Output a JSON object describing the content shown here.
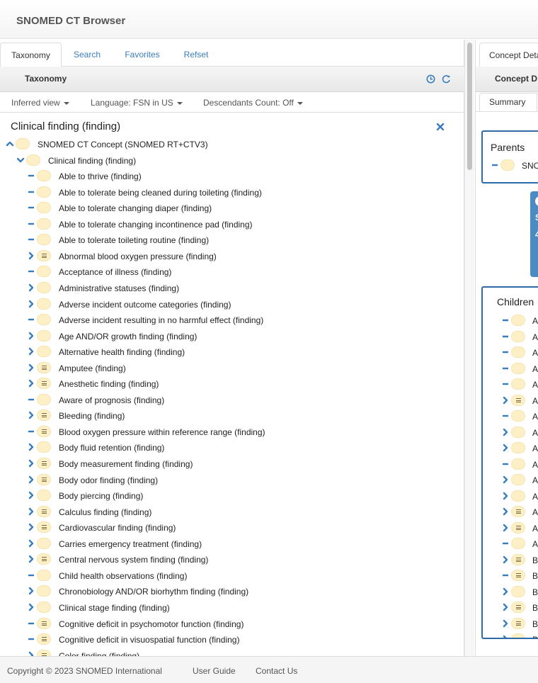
{
  "app": {
    "title": "SNOMED CT Browser"
  },
  "left_tabs": [
    "Taxonomy",
    "Search",
    "Favorites",
    "Refset"
  ],
  "taxonomy_panel": {
    "heading": "Taxonomy",
    "icons": [
      "history-icon",
      "refresh-icon"
    ],
    "view_dropdown": "Inferred view",
    "language_dropdown": "Language: FSN in US",
    "descendants_dropdown": "Descendants Count: Off",
    "selected_concept": "Clinical finding (finding)"
  },
  "tree": [
    {
      "label": "SNOMED CT Concept (SNOMED RT+CTV3)",
      "level": 0,
      "toggle": "collapse",
      "defined": false
    },
    {
      "label": "Clinical finding (finding)",
      "level": 1,
      "toggle": "expanded",
      "defined": false
    },
    {
      "label": "Able to thrive (finding)",
      "level": 2,
      "toggle": "leaf",
      "defined": false
    },
    {
      "label": "Able to tolerate being cleaned during toileting (finding)",
      "level": 2,
      "toggle": "leaf",
      "defined": false
    },
    {
      "label": "Able to tolerate changing diaper (finding)",
      "level": 2,
      "toggle": "leaf",
      "defined": false
    },
    {
      "label": "Able to tolerate changing incontinence pad (finding)",
      "level": 2,
      "toggle": "leaf",
      "defined": false
    },
    {
      "label": "Able to tolerate toileting routine (finding)",
      "level": 2,
      "toggle": "leaf",
      "defined": false
    },
    {
      "label": "Abnormal blood oxygen pressure (finding)",
      "level": 2,
      "toggle": "expand",
      "defined": true
    },
    {
      "label": "Acceptance of illness (finding)",
      "level": 2,
      "toggle": "leaf",
      "defined": false
    },
    {
      "label": "Administrative statuses (finding)",
      "level": 2,
      "toggle": "expand",
      "defined": false
    },
    {
      "label": "Adverse incident outcome categories (finding)",
      "level": 2,
      "toggle": "expand",
      "defined": false
    },
    {
      "label": "Adverse incident resulting in no harmful effect (finding)",
      "level": 2,
      "toggle": "leaf",
      "defined": false
    },
    {
      "label": "Age AND/OR growth finding (finding)",
      "level": 2,
      "toggle": "expand",
      "defined": false
    },
    {
      "label": "Alternative health finding (finding)",
      "level": 2,
      "toggle": "expand",
      "defined": false
    },
    {
      "label": "Amputee (finding)",
      "level": 2,
      "toggle": "expand",
      "defined": true
    },
    {
      "label": "Anesthetic finding (finding)",
      "level": 2,
      "toggle": "expand",
      "defined": true
    },
    {
      "label": "Aware of prognosis (finding)",
      "level": 2,
      "toggle": "leaf",
      "defined": false
    },
    {
      "label": "Bleeding (finding)",
      "level": 2,
      "toggle": "expand",
      "defined": true
    },
    {
      "label": "Blood oxygen pressure within reference range (finding)",
      "level": 2,
      "toggle": "leaf",
      "defined": true
    },
    {
      "label": "Body fluid retention (finding)",
      "level": 2,
      "toggle": "expand",
      "defined": false
    },
    {
      "label": "Body measurement finding (finding)",
      "level": 2,
      "toggle": "expand",
      "defined": true
    },
    {
      "label": "Body odor finding (finding)",
      "level": 2,
      "toggle": "expand",
      "defined": true
    },
    {
      "label": "Body piercing (finding)",
      "level": 2,
      "toggle": "expand",
      "defined": false
    },
    {
      "label": "Calculus finding (finding)",
      "level": 2,
      "toggle": "expand",
      "defined": true
    },
    {
      "label": "Cardiovascular finding (finding)",
      "level": 2,
      "toggle": "expand",
      "defined": true
    },
    {
      "label": "Carries emergency treatment (finding)",
      "level": 2,
      "toggle": "expand",
      "defined": false
    },
    {
      "label": "Central nervous system finding (finding)",
      "level": 2,
      "toggle": "expand",
      "defined": true
    },
    {
      "label": "Child health observations (finding)",
      "level": 2,
      "toggle": "leaf",
      "defined": false
    },
    {
      "label": "Chronobiology AND/OR biorhythm finding (finding)",
      "level": 2,
      "toggle": "expand",
      "defined": false
    },
    {
      "label": "Clinical stage finding (finding)",
      "level": 2,
      "toggle": "expand",
      "defined": false
    },
    {
      "label": "Cognitive deficit in psychomotor function (finding)",
      "level": 2,
      "toggle": "leaf",
      "defined": true
    },
    {
      "label": "Cognitive deficit in visuospatial function (finding)",
      "level": 2,
      "toggle": "leaf",
      "defined": true
    },
    {
      "label": "Color finding (finding)",
      "level": 2,
      "toggle": "expand",
      "defined": true
    }
  ],
  "right_panel": {
    "tab": "Concept Deta",
    "heading": "Concept D",
    "subtab": "Summary",
    "parents_title": "Parents",
    "parent_item": "SNO",
    "card_text_1": "S",
    "card_text_2": "4",
    "children_title": "Children",
    "children": [
      {
        "label": "A",
        "toggle": "leaf",
        "defined": false
      },
      {
        "label": "A",
        "toggle": "leaf",
        "defined": false
      },
      {
        "label": "A",
        "toggle": "leaf",
        "defined": false
      },
      {
        "label": "A",
        "toggle": "leaf",
        "defined": false
      },
      {
        "label": "A",
        "toggle": "leaf",
        "defined": false
      },
      {
        "label": "A",
        "toggle": "expand",
        "defined": true
      },
      {
        "label": "Ac",
        "toggle": "leaf",
        "defined": false
      },
      {
        "label": "Ac",
        "toggle": "expand",
        "defined": false
      },
      {
        "label": "Ac",
        "toggle": "expand",
        "defined": false
      },
      {
        "label": "Ac",
        "toggle": "leaf",
        "defined": false
      },
      {
        "label": "A",
        "toggle": "expand",
        "defined": false
      },
      {
        "label": "A",
        "toggle": "expand",
        "defined": false
      },
      {
        "label": "A",
        "toggle": "expand",
        "defined": true
      },
      {
        "label": "A",
        "toggle": "expand",
        "defined": true
      },
      {
        "label": "A",
        "toggle": "leaf",
        "defined": false
      },
      {
        "label": "B",
        "toggle": "expand",
        "defined": true
      },
      {
        "label": "B",
        "toggle": "leaf",
        "defined": true
      },
      {
        "label": "B",
        "toggle": "expand",
        "defined": false
      },
      {
        "label": "B",
        "toggle": "expand",
        "defined": true
      },
      {
        "label": "B",
        "toggle": "expand",
        "defined": true
      },
      {
        "label": "B",
        "toggle": "expand",
        "defined": false
      }
    ]
  },
  "footer": {
    "copyright": "Copyright © 2023 SNOMED International",
    "user_guide": "User Guide",
    "contact": "Contact Us"
  },
  "colors": {
    "accent": "#3a7dbf",
    "card_blue": "#4a8bc4",
    "box_border": "#2f6aa8",
    "concept_pill": "#fdefc6"
  }
}
